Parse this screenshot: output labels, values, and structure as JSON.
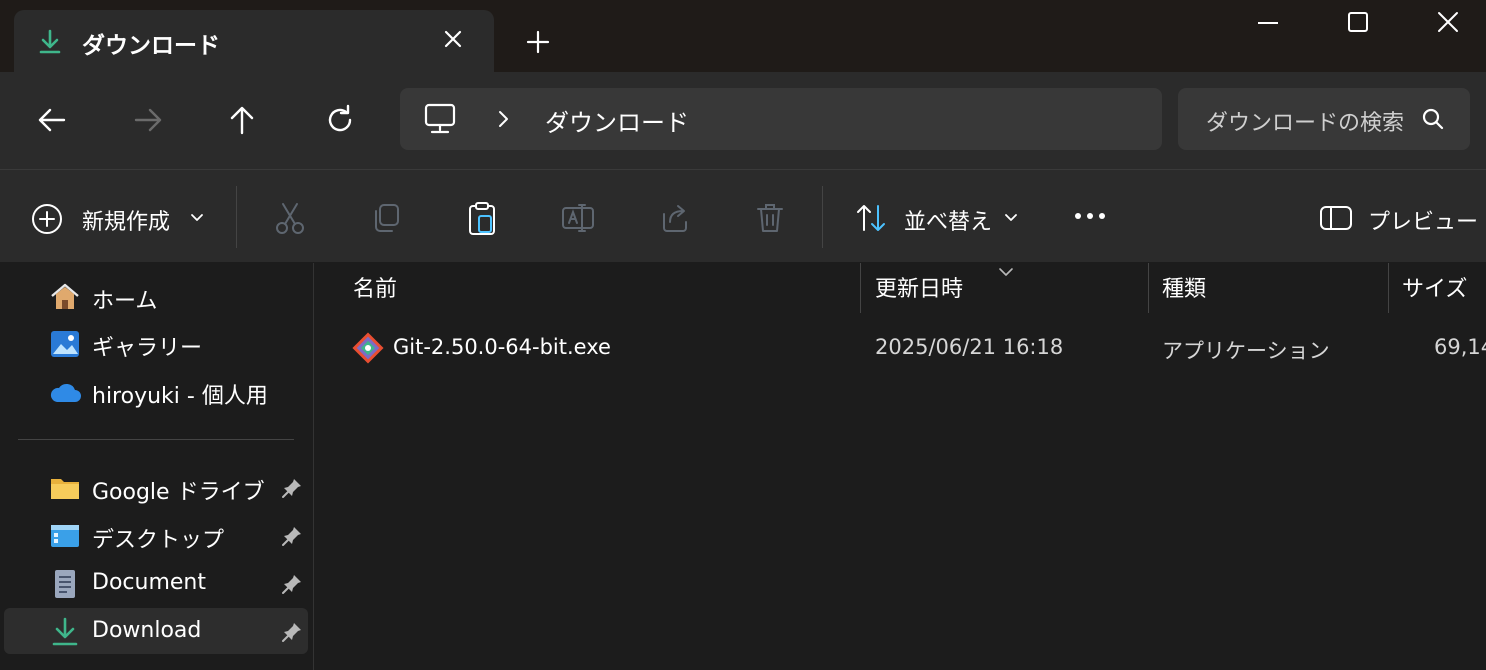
{
  "tab": {
    "title": "ダウンロード"
  },
  "address": {
    "current": "ダウンロード"
  },
  "search": {
    "placeholder": "ダウンロードの検索"
  },
  "commandbar": {
    "new_label": "新規作成",
    "sort_label": "並べ替え",
    "preview_label": "プレビュー"
  },
  "sidebar": {
    "top": [
      {
        "label": "ホーム",
        "icon": "home-icon"
      },
      {
        "label": "ギャラリー",
        "icon": "gallery-icon"
      },
      {
        "label": "hiroyuki - 個人用",
        "icon": "onedrive-cloud-icon"
      }
    ],
    "pinned": [
      {
        "label": "Google ドライブ",
        "icon": "folder-icon"
      },
      {
        "label": "デスクトップ",
        "icon": "desktop-icon"
      },
      {
        "label": "Document",
        "icon": "document-icon"
      },
      {
        "label": "Download",
        "icon": "download-icon"
      }
    ]
  },
  "columns": {
    "name": "名前",
    "modified": "更新日時",
    "type": "種類",
    "size": "サイズ"
  },
  "files": [
    {
      "name": "Git-2.50.0-64-bit.exe",
      "modified": "2025/06/21 16:18",
      "type": "アプリケーション",
      "size": "69,14"
    }
  ],
  "colors": {
    "accent": "#4cc2ff",
    "download_green": "#3fb68b",
    "background": "#1c1c1c",
    "panel": "#2b2b2b"
  }
}
